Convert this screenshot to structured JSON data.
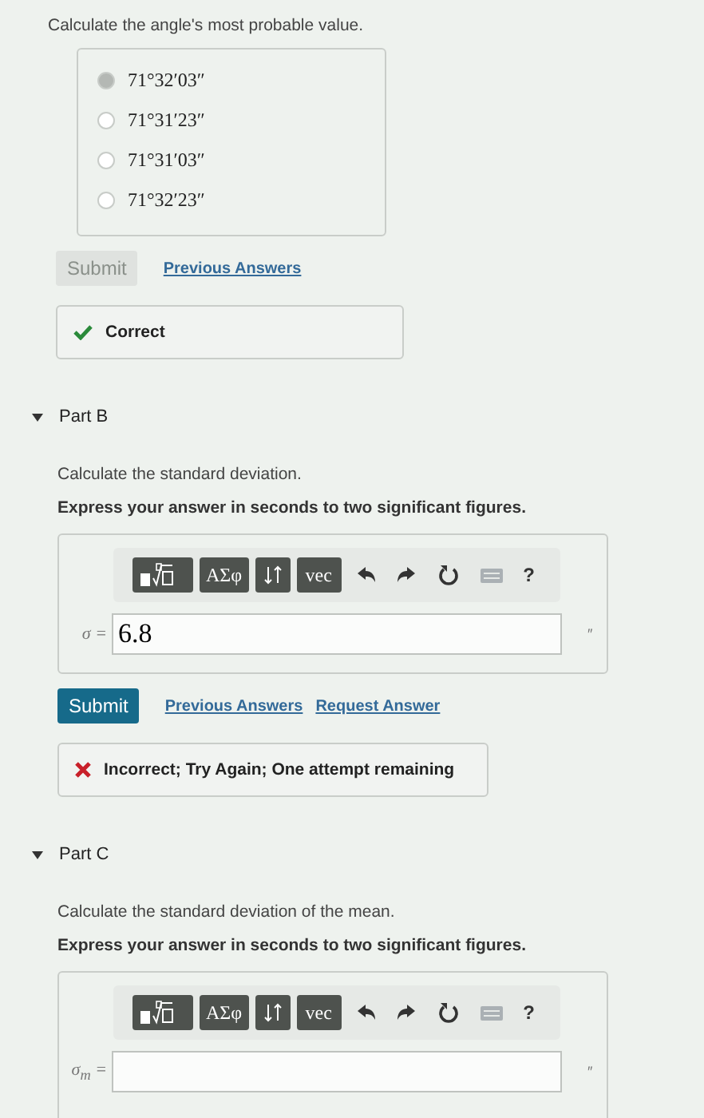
{
  "part_a": {
    "prompt": "Calculate the angle's most probable value.",
    "options": [
      {
        "label": "71°32′03″",
        "selected": true
      },
      {
        "label": "71°31′23″",
        "selected": false
      },
      {
        "label": "71°31′03″",
        "selected": false
      },
      {
        "label": "71°32′23″",
        "selected": false
      }
    ],
    "submit": {
      "label": "Submit",
      "disabled": true
    },
    "links": [
      "Previous Answers"
    ],
    "feedback": {
      "kind": "correct",
      "text": "Correct"
    }
  },
  "parts": [
    {
      "title": "Part B",
      "expanded": true,
      "prompt": "Calculate the standard deviation.",
      "instruction": "Express your answer in seconds to two significant figures.",
      "toolbar": [
        {
          "kind": "templates"
        },
        {
          "kind": "label",
          "label": "ΑΣφ"
        },
        {
          "kind": "arrows"
        },
        {
          "kind": "label",
          "label": "vec"
        },
        {
          "kind": "undo"
        },
        {
          "kind": "redo"
        },
        {
          "kind": "reset"
        },
        {
          "kind": "keyboard"
        },
        {
          "kind": "help",
          "label": "?"
        }
      ],
      "variable": "σ =",
      "value": "6.8",
      "unit": "″",
      "submit": {
        "label": "Submit",
        "disabled": false
      },
      "links": [
        "Previous Answers",
        "Request Answer"
      ],
      "feedback": {
        "kind": "incorrect",
        "text": "Incorrect; Try Again; One attempt remaining"
      }
    },
    {
      "title": "Part C",
      "expanded": true,
      "prompt": "Calculate the standard deviation of the mean.",
      "instruction": "Express your answer in seconds to two significant figures.",
      "toolbar": [
        {
          "kind": "templates"
        },
        {
          "kind": "label",
          "label": "ΑΣφ"
        },
        {
          "kind": "arrows"
        },
        {
          "kind": "label",
          "label": "vec"
        },
        {
          "kind": "undo"
        },
        {
          "kind": "redo"
        },
        {
          "kind": "reset"
        },
        {
          "kind": "keyboard"
        },
        {
          "kind": "help",
          "label": "?"
        }
      ],
      "variable": "σ$_{m}$ =",
      "unit": "″"
    }
  ]
}
